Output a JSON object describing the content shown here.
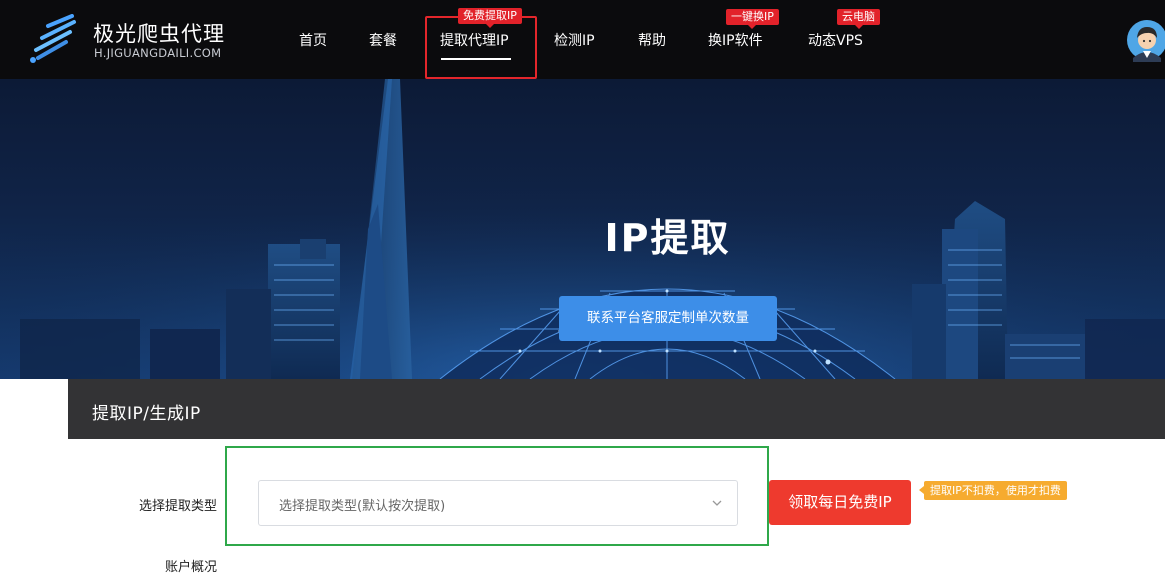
{
  "brand": {
    "name": "极光爬虫代理",
    "domain": "H.JIGUANGDAILI.COM"
  },
  "nav": {
    "home": "首页",
    "packages": "套餐",
    "extract": "提取代理IP",
    "check": "检测IP",
    "help": "帮助",
    "switch": "换IP软件",
    "vps": "动态VPS",
    "badges": {
      "extract": "免费提取IP",
      "switch": "一键换IP",
      "vps": "云电脑"
    }
  },
  "hero": {
    "title": "IP提取",
    "button": "联系平台客服定制单次数量"
  },
  "section": {
    "title": "提取IP/生成IP"
  },
  "form": {
    "type_label": "选择提取类型",
    "type_placeholder": "选择提取类型(默认按次提取)",
    "free_button": "领取每日免费IP",
    "tip": "提取IP不扣费，使用才扣费",
    "account_label": "账户概况"
  },
  "colors": {
    "header_bg": "#0b0b0d",
    "accent_blue": "#3d8ee8",
    "accent_red": "#ee3a2e",
    "tip_orange": "#f6ab2f",
    "highlight_green": "#2fa84a"
  }
}
